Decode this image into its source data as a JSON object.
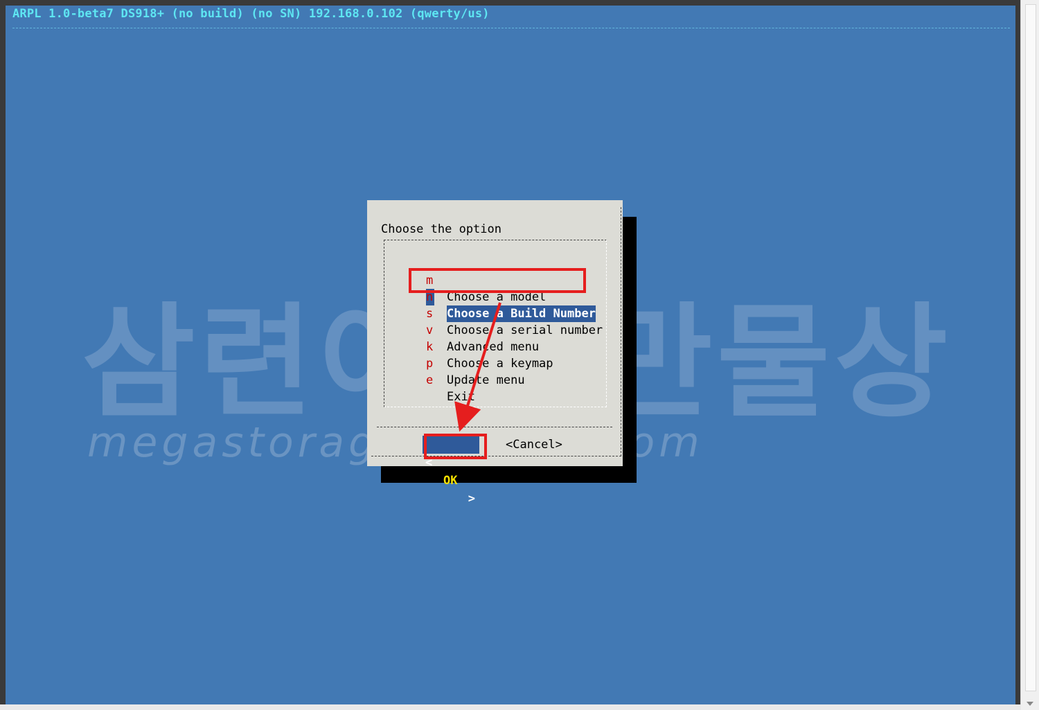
{
  "terminal": {
    "status_line": "ARPL 1.0-beta7 DS918+ (no build) (no SN) 192.168.0.102 (qwerty/us)"
  },
  "watermark": {
    "korean": "삼련이의 만물상",
    "url": "megastorage.tistory.com"
  },
  "dialog": {
    "prompt": "Choose the option",
    "items": [
      {
        "key": "m",
        "label": "Choose a model"
      },
      {
        "key": "n",
        "label": "Choose a Build Number",
        "selected": true
      },
      {
        "key": "s",
        "label": "Choose a serial number"
      },
      {
        "key": "v",
        "label": "Advanced menu"
      },
      {
        "key": "k",
        "label": "Choose a keymap"
      },
      {
        "key": "p",
        "label": "Update menu"
      },
      {
        "key": "e",
        "label": "Exit"
      }
    ],
    "buttons": {
      "ok_left": "<",
      "ok": "OK",
      "ok_right": ">",
      "cancel": "<Cancel>"
    }
  },
  "annotation": {
    "highlight_color": "#e51e1e",
    "highlighted": [
      "Choose a Build Number",
      "OK"
    ]
  }
}
